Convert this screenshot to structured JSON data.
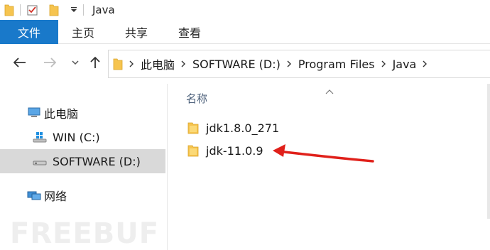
{
  "window": {
    "title": "Java"
  },
  "ribbon": {
    "tabs": [
      {
        "label": "文件"
      },
      {
        "label": "主页"
      },
      {
        "label": "共享"
      },
      {
        "label": "查看"
      }
    ]
  },
  "address": {
    "crumbs": [
      "此电脑",
      "SOFTWARE (D:)",
      "Program Files",
      "Java"
    ]
  },
  "navpane": {
    "items": [
      {
        "label": "此电脑",
        "icon": "computer-icon"
      },
      {
        "label": "WIN (C:)",
        "icon": "windows-drive-icon"
      },
      {
        "label": "SOFTWARE (D:)",
        "icon": "drive-icon",
        "selected": true
      },
      {
        "label": "网络",
        "icon": "network-icon"
      }
    ]
  },
  "content": {
    "column_header": "名称",
    "files": [
      {
        "name": "jdk1.8.0_271",
        "icon": "folder-icon"
      },
      {
        "name": "jdk-11.0.9",
        "icon": "folder-icon"
      }
    ]
  },
  "watermark": "FREEBUF",
  "colors": {
    "file_tab": "#1979ca",
    "selection": "#d9d9d9",
    "folder": "#f6c44f",
    "annotation_arrow": "#e0201a"
  }
}
